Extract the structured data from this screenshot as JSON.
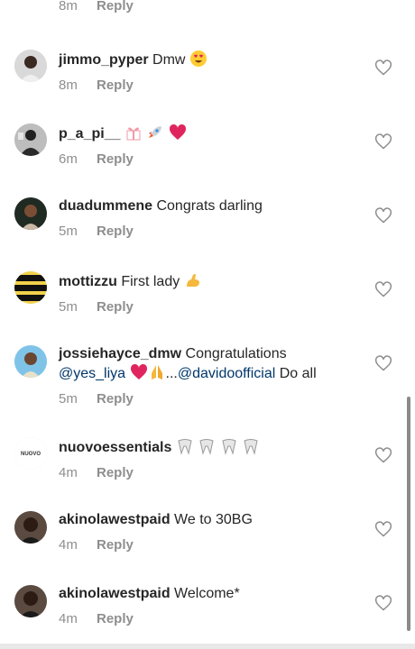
{
  "header_row": {
    "time": "8m",
    "reply_label": "Reply"
  },
  "comments": [
    {
      "username": "jimmo_pyper",
      "text": "Dmw",
      "emojis": [
        "heart-eyes"
      ],
      "time": "8m",
      "reply_label": "Reply"
    },
    {
      "username": "p_a_pi__",
      "text": "",
      "emojis": [
        "gift",
        "rocket",
        "red-heart"
      ],
      "time": "6m",
      "reply_label": "Reply"
    },
    {
      "username": "duadummene",
      "text": "Congrats darling",
      "emojis": [],
      "time": "5m",
      "reply_label": "Reply"
    },
    {
      "username": "mottizzu",
      "text": "First lady",
      "emojis": [
        "flexed-biceps"
      ],
      "time": "5m",
      "reply_label": "Reply"
    },
    {
      "username": "jossiehayce_dmw",
      "text": "Congratulations",
      "line2_mention": "@yes_liya",
      "line2_ellipsis": "...",
      "line2_mention2": "@davidoofficial",
      "line2_tail": "Do all",
      "emojis": [
        "red-heart",
        "folded-hands"
      ],
      "time": "5m",
      "reply_label": "Reply"
    },
    {
      "username": "nuovoessentials",
      "text": "",
      "emojis": [
        "tooth",
        "tooth",
        "tooth",
        "tooth"
      ],
      "avatar_text": "NUOVO",
      "time": "4m",
      "reply_label": "Reply"
    },
    {
      "username": "akinolawestpaid",
      "text": "We to 30BG",
      "emojis": [],
      "time": "4m",
      "reply_label": "Reply"
    },
    {
      "username": "akinolawestpaid",
      "text": "Welcome*",
      "emojis": [],
      "time": "4m",
      "reply_label": "Reply"
    }
  ],
  "icons": {
    "like": "heart-outline-icon"
  },
  "colors": {
    "text": "#262626",
    "muted": "#8e8e8e",
    "link": "#00376b",
    "heart_red": "#e0245e"
  }
}
